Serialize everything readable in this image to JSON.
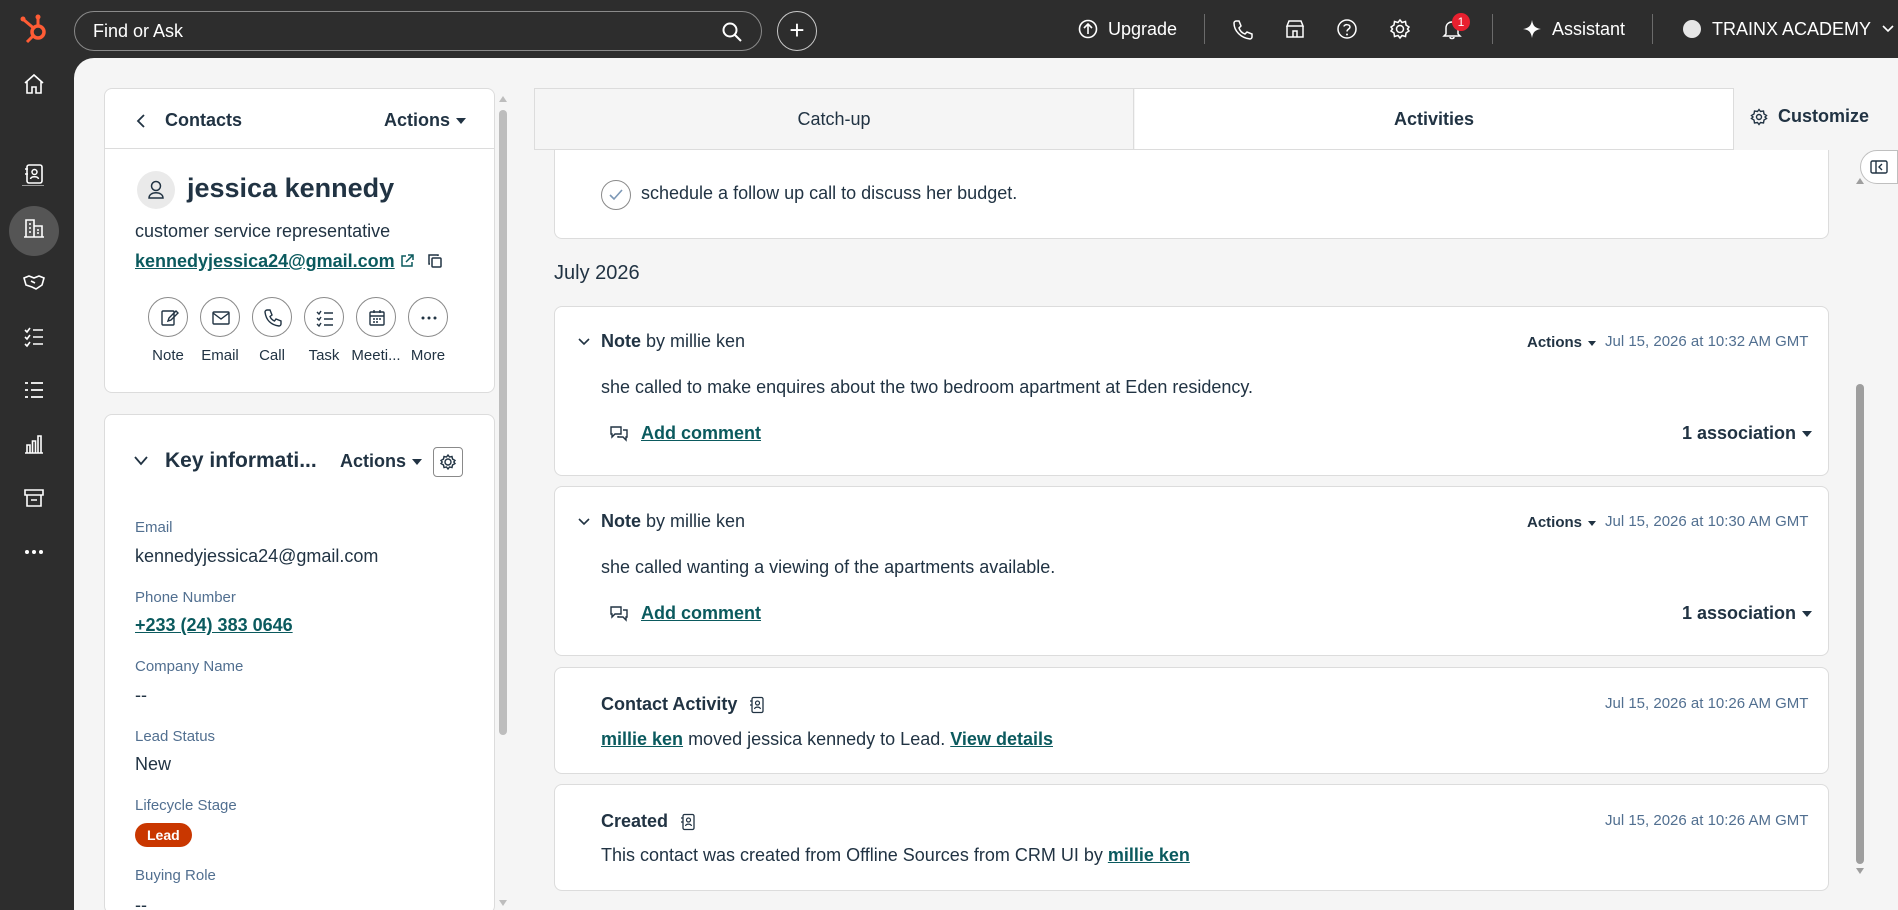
{
  "topbar": {
    "search_placeholder": "Find or Ask",
    "upgrade": "Upgrade",
    "assistant": "Assistant",
    "account": "TRAINX ACADEMY",
    "notification_count": "1"
  },
  "contact_card": {
    "back_label": "Contacts",
    "actions_label": "Actions",
    "name": "jessica kennedy",
    "job_title": "customer service representative",
    "email": "kennedyjessica24@gmail.com",
    "quick_actions": [
      "Note",
      "Email",
      "Call",
      "Task",
      "Meeti...",
      "More"
    ]
  },
  "key_info": {
    "title": "Key informati...",
    "actions_label": "Actions",
    "fields": [
      {
        "label": "Email",
        "value": "kennedyjessica24@gmail.com"
      },
      {
        "label": "Phone Number",
        "value": "+233 (24) 383 0646"
      },
      {
        "label": "Company Name",
        "value": "--"
      },
      {
        "label": "Lead Status",
        "value": "New"
      },
      {
        "label": "Lifecycle Stage",
        "value": "Lead"
      },
      {
        "label": "Buying Role",
        "value": "--"
      }
    ]
  },
  "tabs": [
    "Catch-up",
    "Activities"
  ],
  "customize_label": "Customize",
  "timeline": {
    "task_text": "schedule a follow up call to discuss her budget.",
    "month": "July 2026",
    "notes": [
      {
        "type": "Note",
        "by": "by millie ken",
        "actions": "Actions",
        "timestamp": "Jul 15, 2026 at 10:32 AM GMT",
        "body": "she called to make enquires about the two bedroom apartment at Eden residency.",
        "comment_label": "Add comment",
        "association": "1 association"
      },
      {
        "type": "Note",
        "by": "by millie ken",
        "actions": "Actions",
        "timestamp": "Jul 15, 2026 at 10:30 AM GMT",
        "body": "she called wanting a viewing of the apartments available.",
        "comment_label": "Add comment",
        "association": "1 association"
      }
    ],
    "contact_activity": {
      "title": "Contact Activity",
      "timestamp": "Jul 15, 2026 at 10:26 AM GMT",
      "actor": "millie ken",
      "text": "moved jessica kennedy to Lead.",
      "link": "View details"
    },
    "created": {
      "title": "Created",
      "timestamp": "Jul 15, 2026 at 10:26 AM GMT",
      "text": "This contact was created from Offline Sources from CRM UI by",
      "actor": "millie ken"
    }
  },
  "colors": {
    "brand_orange": "#ff5c35",
    "link_teal": "#0b5a5e",
    "lead_badge": "#c93700",
    "nav_dark": "#2d2d2d"
  }
}
